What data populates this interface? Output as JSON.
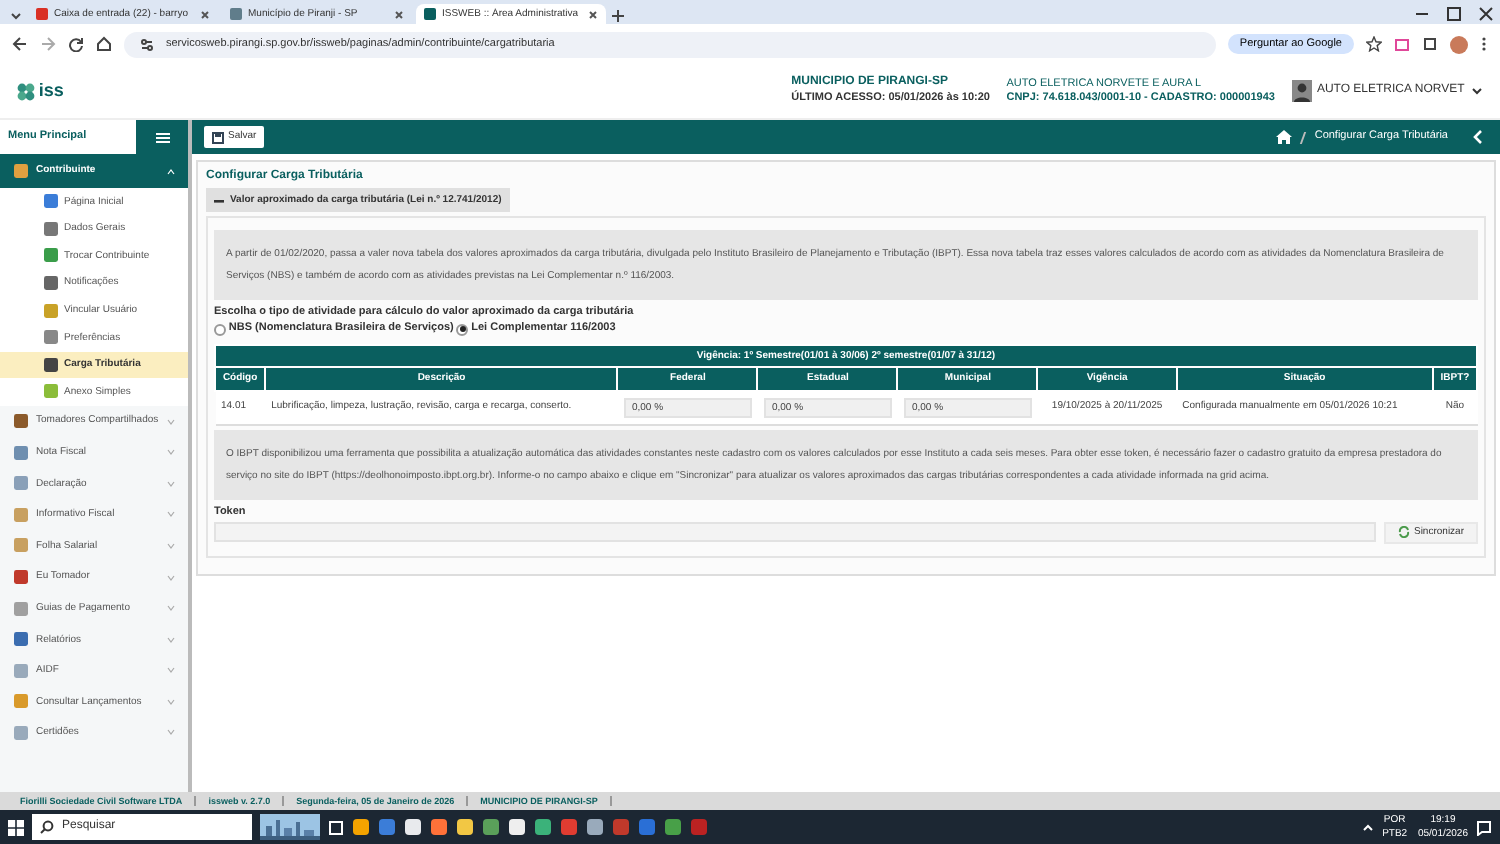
{
  "browser": {
    "tabs": [
      {
        "title": "Caixa de entrada (22) - barryo",
        "selected": false,
        "color": "#d93025"
      },
      {
        "title": "Município de Piranji - SP",
        "selected": false,
        "color": "#607d8b"
      },
      {
        "title": "ISSWEB :: Área Administrativa",
        "selected": true,
        "color": "#0a5f5f"
      }
    ],
    "url": "servicosweb.pirangi.sp.gov.br/issweb/paginas/admin/contribuinte/cargatributaria",
    "ask": "Perguntar ao Google"
  },
  "header": {
    "logo": "iss",
    "municipality": "MUNICIPIO DE PIRANGI-SP",
    "last_access": "ÚLTIMO ACESSO: 05/01/2026 às 10:20",
    "company": "AUTO ELETRICA NORVETE E AURA L",
    "cnpj": "CNPJ: 74.618.043/0001-10 - CADASTRO: 000001943",
    "user": "AUTO ELETRICA NORVET"
  },
  "toolbar": {
    "save": "Salvar",
    "breadcrumb": "Configurar Carga Tributária"
  },
  "sidebar": {
    "title": "Menu Principal",
    "items": [
      {
        "label": "Contribuinte",
        "expanded": true,
        "children": [
          {
            "label": "Página Inicial",
            "selected": false
          },
          {
            "label": "Dados Gerais",
            "selected": false
          },
          {
            "label": "Trocar Contribuinte",
            "selected": false
          },
          {
            "label": "Notificações",
            "selected": false
          },
          {
            "label": "Vincular Usuário",
            "selected": false
          },
          {
            "label": "Preferências",
            "selected": false
          },
          {
            "label": "Carga Tributária",
            "selected": true
          },
          {
            "label": "Anexo Simples",
            "selected": false
          }
        ]
      },
      {
        "label": "Tomadores Compartilhados",
        "expanded": false
      },
      {
        "label": "Nota Fiscal",
        "expanded": false
      },
      {
        "label": "Declaração",
        "expanded": false
      },
      {
        "label": "Informativo Fiscal",
        "expanded": false
      },
      {
        "label": "Folha Salarial",
        "expanded": false
      },
      {
        "label": "Eu Tomador",
        "expanded": false
      },
      {
        "label": "Guias de Pagamento",
        "expanded": false
      },
      {
        "label": "Relatórios",
        "expanded": false
      },
      {
        "label": "AIDF",
        "expanded": false
      },
      {
        "label": "Consultar Lançamentos",
        "expanded": false
      },
      {
        "label": "Certidões",
        "expanded": false
      }
    ]
  },
  "content": {
    "title": "Configurar Carga Tributária",
    "legend": "Valor aproximado da carga tributária (Lei n.º 12.741/2012)",
    "intro": "A partir de 01/02/2020, passa a valer nova tabela dos valores aproximados da carga tributária, divulgada pelo Instituto Brasileiro de Planejamento e Tributação (IBPT). Essa nova tabela traz esses valores calculados de acordo com as atividades da Nomenclatura Brasileira de Serviços (NBS) e também de acordo com as atividades previstas na Lei Complementar n.º 116/2003.",
    "choice_label": "Escolha o tipo de atividade para cálculo do valor aproximado da carga tributária",
    "options": [
      {
        "label": "NBS (Nomenclatura Brasileira de Serviços)",
        "selected": false
      },
      {
        "label": "Lei Complementar 116/2003",
        "selected": true
      }
    ],
    "table": {
      "caption": "Vigência: 1º Semestre(01/01 à 30/06) 2º semestre(01/07 à 31/12)",
      "columns": [
        "Código",
        "Descrição",
        "Federal",
        "Estadual",
        "Municipal",
        "Vigência",
        "Situação",
        "IBPT?"
      ],
      "rows": [
        {
          "code": "14.01",
          "description": "Lubrificação, limpeza, lustração, revisão, carga e recarga, conserto.",
          "federal": "0,00 %",
          "state": "0,00 %",
          "municipal": "0,00 %",
          "validity": "19/10/2025 à 20/11/2025",
          "status": "Configurada manualmente em 05/01/2026 10:21",
          "ibpt": "Não"
        }
      ]
    },
    "note": "O IBPT disponibilizou uma ferramenta que possibilita a atualização automática das atividades constantes neste cadastro com os valores calculados por esse Instituto a cada seis meses. Para obter esse token, é necessário fazer o cadastro gratuito da empresa prestadora do serviço no site do IBPT (https://deolhonoimposto.ibpt.org.br). Informe-o no campo abaixo e clique em \"Sincronizar\" para atualizar os valores aproximados das cargas tributárias correspondentes a cada atividade informada na grid acima.",
    "token_label": "Token",
    "sync": "Sincronizar"
  },
  "status_bar": [
    "Fiorilli Sociedade Civil Software LTDA",
    "issweb v. 2.7.0",
    "Segunda-feira, 05 de Janeiro de 2026",
    "MUNICIPIO DE PIRANGI-SP"
  ],
  "taskbar": {
    "search": "Pesquisar",
    "lang": "POR",
    "layout": "PTB2",
    "time": "19:19",
    "date": "05/01/2026"
  }
}
